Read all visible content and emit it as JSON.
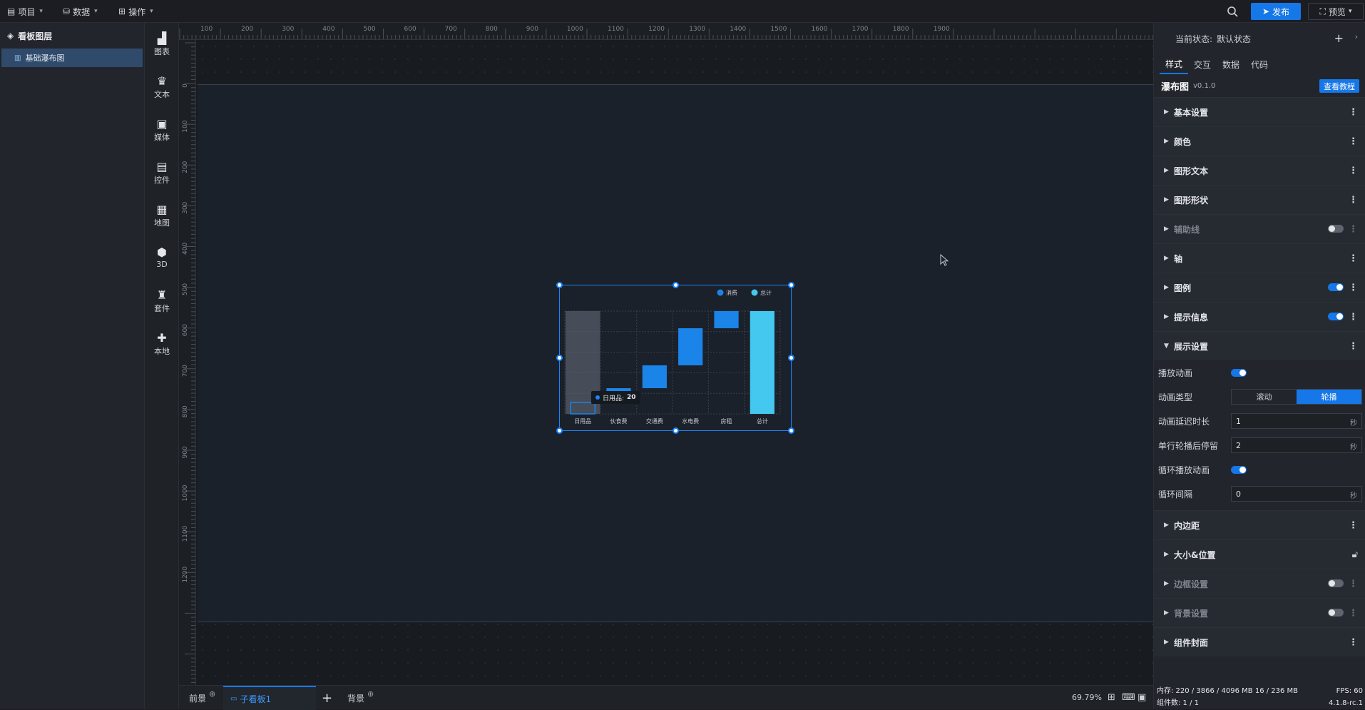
{
  "topbar": {
    "menu_project": "项目",
    "menu_data": "数据",
    "menu_operate": "操作",
    "publish_label": "发布",
    "preview_label": "预览"
  },
  "layers": {
    "title": "看板图层",
    "items": [
      {
        "label": "基础瀑布图"
      }
    ]
  },
  "tools": [
    {
      "label": "图表",
      "icon": "bar-chart-icon"
    },
    {
      "label": "文本",
      "icon": "text-icon"
    },
    {
      "label": "媒体",
      "icon": "media-icon"
    },
    {
      "label": "控件",
      "icon": "control-icon"
    },
    {
      "label": "地图",
      "icon": "map-icon"
    },
    {
      "label": "3D",
      "icon": "cube-icon"
    },
    {
      "label": "套件",
      "icon": "shirt-icon"
    },
    {
      "label": "本地",
      "icon": "puzzle-icon"
    }
  ],
  "ruler": {
    "top": [
      "100",
      "200",
      "300",
      "400",
      "500",
      "600",
      "700",
      "800",
      "900",
      "1000",
      "1100",
      "1200",
      "1300",
      "1400",
      "1500",
      "1600",
      "1700",
      "1800",
      "1900"
    ],
    "left": [
      "0",
      "100",
      "200",
      "300",
      "400",
      "500",
      "600",
      "700",
      "800",
      "900",
      "1000",
      "1100",
      "1200"
    ]
  },
  "chart_data": {
    "type": "bar",
    "subtype": "waterfall",
    "categories": [
      "日用品",
      "伙食费",
      "交通费",
      "水电费",
      "房租",
      "总计"
    ],
    "series": [
      {
        "name": "消费",
        "color": "#1a84e8"
      },
      {
        "name": "总计",
        "color": "#44c8f0"
      }
    ],
    "increments": [
      20,
      25,
      40,
      65,
      30
    ],
    "total": 180,
    "ylim": [
      0,
      180
    ],
    "tooltip": {
      "label": "日用品:",
      "value": "20"
    },
    "hover_category": "日用品",
    "legend_position": "top-right"
  },
  "bottombar": {
    "tab_front": "前景",
    "tab_sub": "子看板1",
    "tab_back": "背景",
    "zoom": "69.79%"
  },
  "rightpanel": {
    "state_label": "当前状态:",
    "state_value": "默认状态",
    "tabs": [
      "样式",
      "交互",
      "数据",
      "代码"
    ],
    "component_name": "瀑布图",
    "component_version": "v0.1.0",
    "tutorial_label": "查看教程",
    "sections_top": [
      {
        "label": "基本设置"
      },
      {
        "label": "颜色"
      },
      {
        "label": "图形文本"
      },
      {
        "label": "图形形状"
      },
      {
        "label": "辅助线"
      },
      {
        "label": "轴"
      },
      {
        "label": "图例"
      },
      {
        "label": "提示信息"
      }
    ],
    "display_section": "展示设置",
    "display": {
      "play_anim": "播放动画",
      "anim_type": "动画类型",
      "anim_opt_scroll": "滚动",
      "anim_opt_carousel": "轮播",
      "delay_label": "动画延迟时长",
      "delay_value": "1",
      "stay_label": "单行轮播后停留",
      "stay_value": "2",
      "loop_label": "循环播放动画",
      "interval_label": "循环间隔",
      "interval_value": "0",
      "unit_sec": "秒"
    },
    "sections_bottom": [
      {
        "label": "内边距"
      },
      {
        "label": "大小&位置"
      },
      {
        "label": "边框设置"
      },
      {
        "label": "背景设置"
      },
      {
        "label": "组件封面"
      }
    ],
    "status": {
      "memory": "内存: 220 / 3866 / 4096 MB  16 / 236 MB",
      "fps": "FPS: 60",
      "count": "组件数: 1 / 1",
      "version": "4.1.8-rc.1"
    }
  }
}
